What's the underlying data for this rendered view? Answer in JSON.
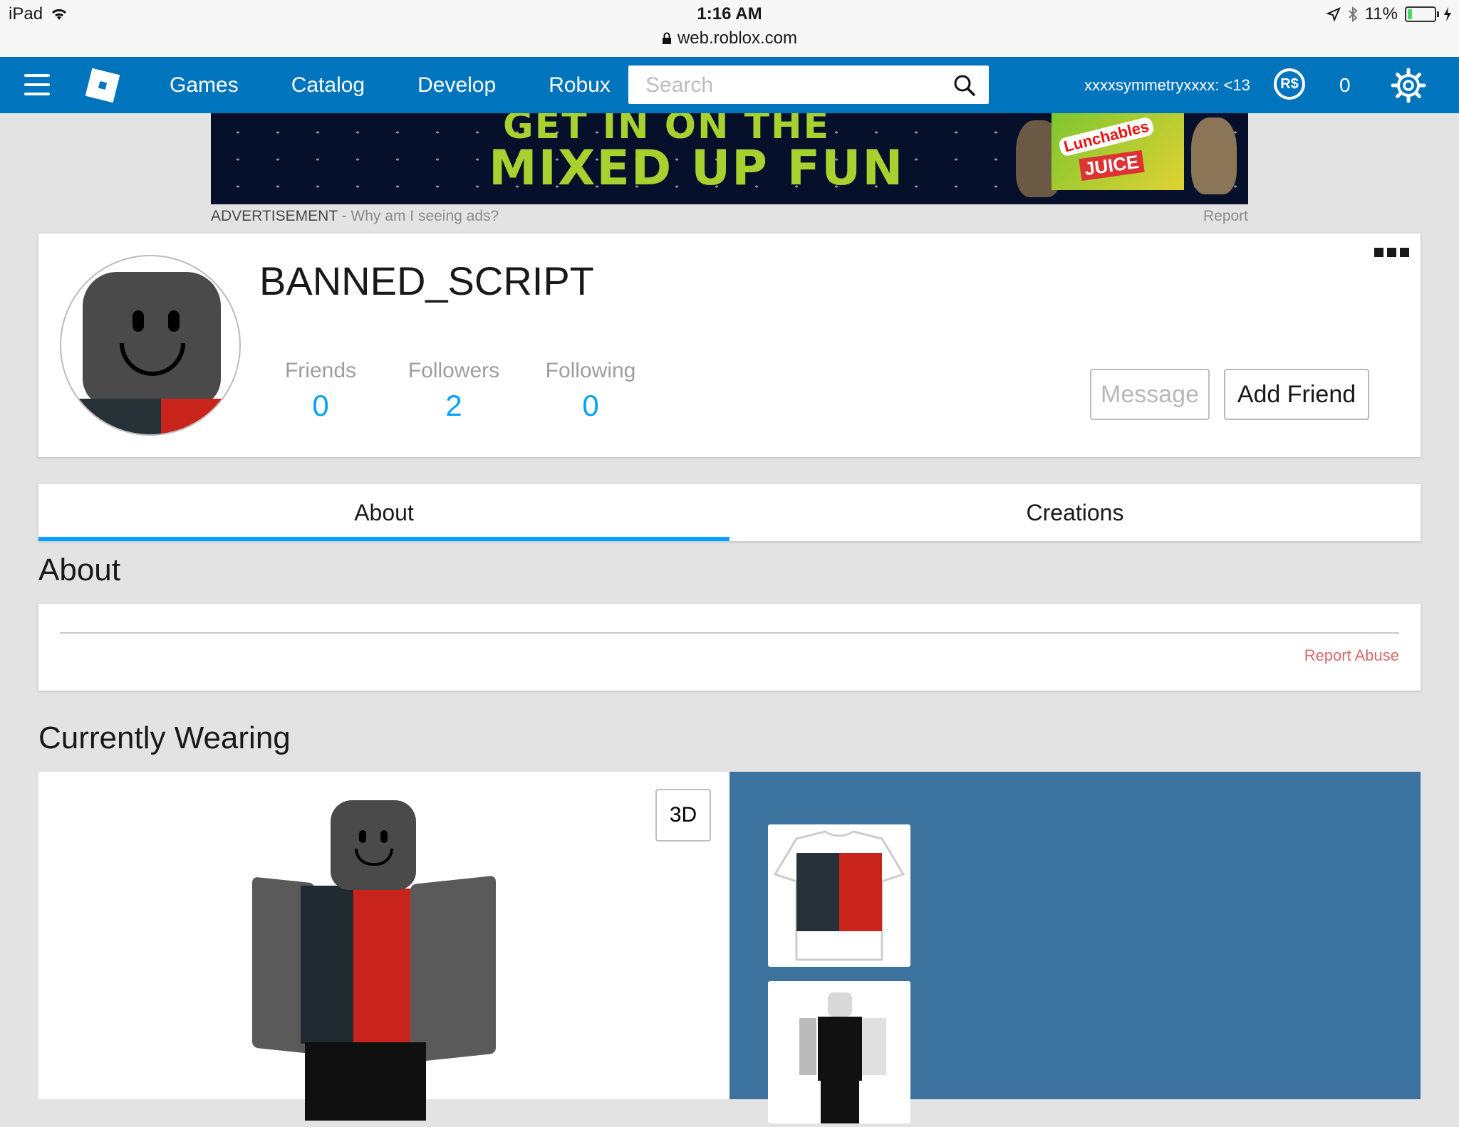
{
  "status_bar": {
    "device": "iPad",
    "time": "1:16 AM",
    "url": "web.roblox.com",
    "battery": "11%"
  },
  "nav": {
    "links": [
      "Games",
      "Catalog",
      "Develop",
      "Robux"
    ],
    "search_placeholder": "Search",
    "username": "xxxxsymmetryxxxx: <13",
    "robux_symbol": "R$",
    "robux_count": "0"
  },
  "ad": {
    "line1": "GET IN ON THE",
    "line2": "MIXED UP FUN",
    "brand": "Lunchables",
    "product": "JUICE",
    "label": "ADVERTISEMENT",
    "why": " - Why am I seeing ads?",
    "report": "Report"
  },
  "profile": {
    "name": "BANNED_SCRIPT",
    "stats": [
      {
        "label": "Friends",
        "value": "0"
      },
      {
        "label": "Followers",
        "value": "2"
      },
      {
        "label": "Following",
        "value": "0"
      }
    ],
    "message_label": "Message",
    "add_friend_label": "Add Friend"
  },
  "tabs": [
    {
      "label": "About",
      "active": true
    },
    {
      "label": "Creations",
      "active": false
    }
  ],
  "about": {
    "title": "About",
    "report_abuse": "Report Abuse"
  },
  "wearing": {
    "title": "Currently Wearing",
    "toggle_label": "3D"
  },
  "colors": {
    "nav_blue": "#0074bd",
    "accent_blue": "#00a2ff",
    "wearing_panel": "#3b739e",
    "shirt_red": "#c8241c",
    "shirt_dark": "#263238"
  }
}
